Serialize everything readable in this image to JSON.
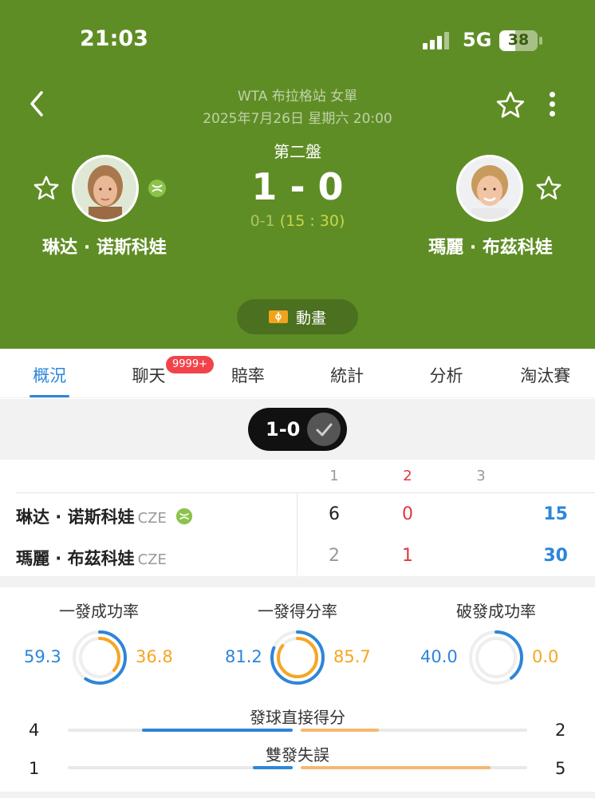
{
  "status": {
    "time": "21:03",
    "network": "5G",
    "battery": "38"
  },
  "match": {
    "event": "WTA 布拉格站 女單",
    "datetime": "2025年7月26日 星期六 20:00",
    "set_label": "第二盤",
    "score": "1 - 0",
    "game_score_prefix": "0-1",
    "game_points": "(15 : 30)",
    "player1": {
      "name": "琳达 · 诺斯科娃",
      "country": "CZE"
    },
    "player2": {
      "name": "瑪麗 · 布茲科娃",
      "country": "CZE"
    },
    "animation_label": "動畫"
  },
  "tabs": [
    "概況",
    "聊天",
    "賠率",
    "統計",
    "分析",
    "淘汰賽"
  ],
  "chat_badge": "9999+",
  "series_pill": "1-0",
  "scoreboard": {
    "headers": [
      "1",
      "2",
      "3"
    ],
    "rows": [
      {
        "name": "琳达 · 诺斯科娃",
        "country": "CZE",
        "sets": [
          "6",
          "0"
        ],
        "points": "15"
      },
      {
        "name": "瑪麗 · 布茲科娃",
        "country": "CZE",
        "sets": [
          "2",
          "1"
        ],
        "points": "30"
      }
    ]
  },
  "stats": [
    {
      "title": "一發成功率",
      "left": "59.3",
      "right": "36.8"
    },
    {
      "title": "一發得分率",
      "left": "81.2",
      "right": "85.7"
    },
    {
      "title": "破發成功率",
      "left": "40.0",
      "right": "0.0"
    }
  ],
  "bars": [
    {
      "title": "發球直接得分",
      "left": "4",
      "right": "2"
    },
    {
      "title": "雙發失誤",
      "left": "1",
      "right": "5"
    }
  ],
  "colors": {
    "header_green": "#5f8d25",
    "accent_blue": "#2d86d8",
    "accent_orange": "#f5a623",
    "badge_red": "#f2434b"
  }
}
